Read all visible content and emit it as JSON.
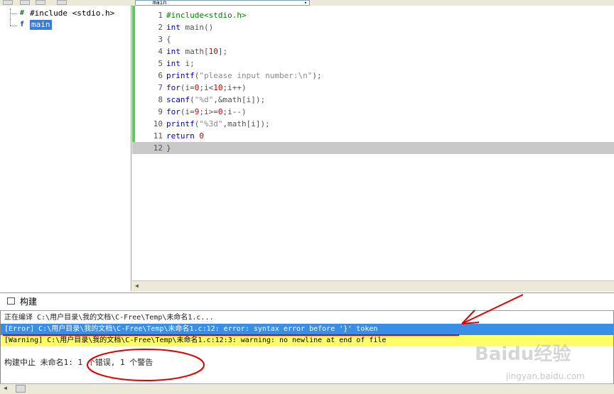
{
  "toolbar": {
    "function_select_value": "main",
    "function_select_arrow": "▾"
  },
  "tree": {
    "items": [
      {
        "icon": "#",
        "label": "#include <stdio.h>",
        "selected": false
      },
      {
        "icon": "f",
        "label": "main",
        "selected": true
      }
    ]
  },
  "editor": {
    "lines": [
      {
        "n": "1",
        "text": "#include<stdio.h>"
      },
      {
        "n": "2",
        "text": "int main()"
      },
      {
        "n": "3",
        "text": "{"
      },
      {
        "n": "4",
        "text": "int math[10];"
      },
      {
        "n": "5",
        "text": "int i;"
      },
      {
        "n": "6",
        "text": "printf(\"please input number:\\n\");"
      },
      {
        "n": "7",
        "text": "for(i=0;i<10;i++)"
      },
      {
        "n": "8",
        "text": "scanf(\"%d\",&math[i]);"
      },
      {
        "n": "9",
        "text": "for(i=9;i>=0;i--)"
      },
      {
        "n": "10",
        "text": "printf(\"%3d\",math[i]);"
      },
      {
        "n": "11",
        "text": "return 0"
      },
      {
        "n": "12",
        "text": "}"
      }
    ],
    "current_line": 12
  },
  "build": {
    "tab_label": "构建",
    "compiling": "正在编译 C:\\用户目录\\我的文档\\C-Free\\Temp\\未命名1.c...",
    "error": "[Error] C:\\用户目录\\我的文档\\C-Free\\Temp\\未命名1.c:12: error: syntax error before '}' token",
    "warning": "[Warning] C:\\用户目录\\我的文档\\C-Free\\Temp\\未命名1.c:12:3: warning: no newline at end of file",
    "summary": "构建中止 未命名1: 1 个错误, 1 个警告"
  },
  "watermark": {
    "main": "Baidu经验",
    "sub": "jingyan.baidu.com"
  },
  "colors": {
    "keyword": "#0000c8",
    "error_bg": "#3a8ee6",
    "warning_bg": "#ffff66",
    "annotation_red": "#e00000",
    "modified_bar": "#5ec95e"
  }
}
